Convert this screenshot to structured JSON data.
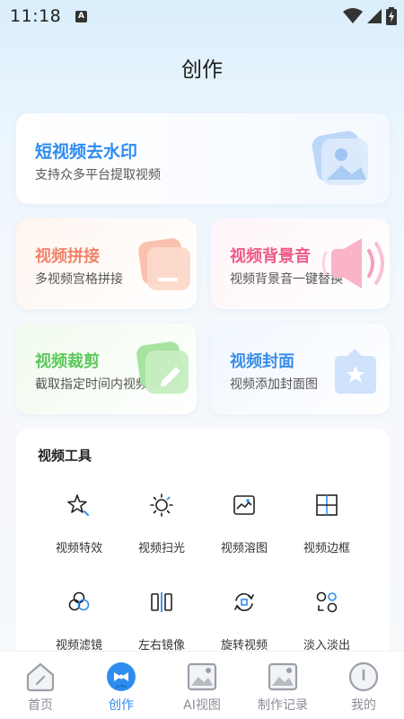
{
  "status_bar": {
    "time": "11:18",
    "notification_badge": "A",
    "icons": [
      "wifi-icon",
      "signal-icon",
      "battery-charging-icon"
    ]
  },
  "page_title": "创作",
  "feature_cards": {
    "watermark": {
      "title": "短视频去水印",
      "subtitle": "支持众多平台提取视频",
      "icon": "image-stack-icon",
      "color": "#2f8cef"
    },
    "splice": {
      "title": "视频拼接",
      "subtitle": "多视频宫格拼接",
      "icon": "grid-stack-icon",
      "color": "#f0836a"
    },
    "bgm": {
      "title": "视频背景音",
      "subtitle": "视频背景音一键替换",
      "icon": "speaker-icon",
      "color": "#ee5a86"
    },
    "crop": {
      "title": "视频裁剪",
      "subtitle": "截取指定时间内视频",
      "icon": "edit-pen-icon",
      "color": "#5bc85a"
    },
    "cover": {
      "title": "视频封面",
      "subtitle": "视频添加封面图",
      "icon": "star-cover-icon",
      "color": "#3b8de8"
    }
  },
  "tools": {
    "title": "视频工具",
    "items": [
      {
        "label": "视频特效",
        "icon": "sparkle-star-icon"
      },
      {
        "label": "视频扫光",
        "icon": "sun-icon"
      },
      {
        "label": "视频溶图",
        "icon": "image-blend-icon"
      },
      {
        "label": "视频边框",
        "icon": "frame-grid-icon"
      },
      {
        "label": "视频滤镜",
        "icon": "filter-circles-icon"
      },
      {
        "label": "左右镜像",
        "icon": "mirror-icon"
      },
      {
        "label": "旋转视频",
        "icon": "rotate-icon"
      },
      {
        "label": "淡入淡出",
        "icon": "fade-icon"
      }
    ]
  },
  "bottom_nav": {
    "items": [
      {
        "label": "首页",
        "icon": "home-icon",
        "active": false
      },
      {
        "label": "创作",
        "icon": "create-bowtie-icon",
        "active": true
      },
      {
        "label": "AI视图",
        "icon": "ai-image-icon",
        "active": false
      },
      {
        "label": "制作记录",
        "icon": "record-image-icon",
        "active": false
      },
      {
        "label": "我的",
        "icon": "profile-icon",
        "active": false
      }
    ],
    "active_color": "#2f8cef",
    "inactive_color": "#8a8f99"
  }
}
